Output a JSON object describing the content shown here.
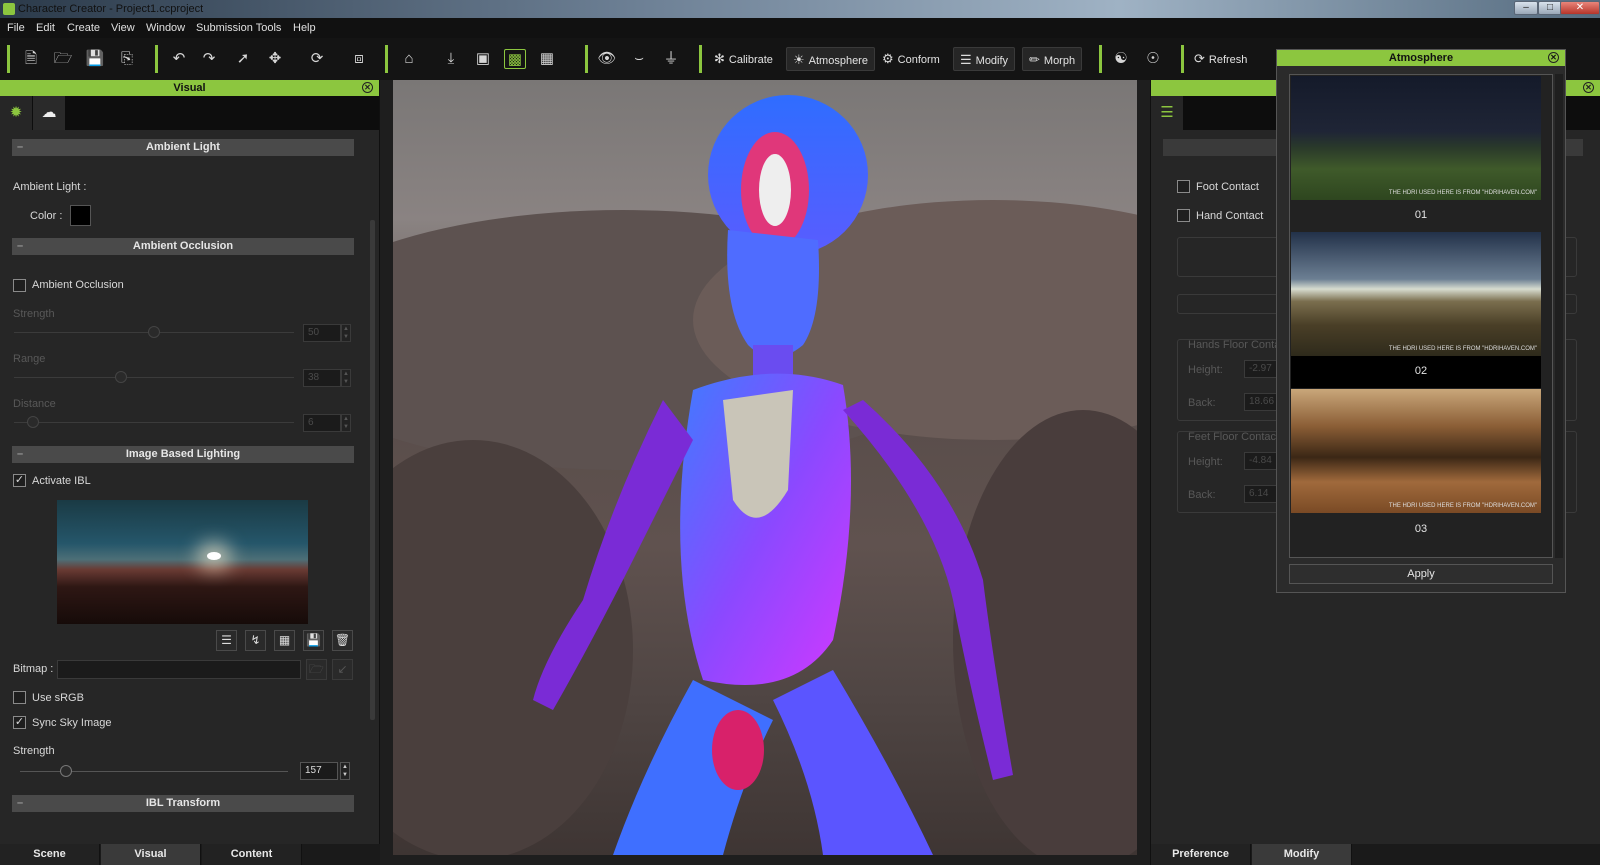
{
  "window": {
    "title": "Character Creator - Project1.ccproject"
  },
  "menu": [
    "File",
    "Edit",
    "Create",
    "View",
    "Window",
    "Submission Tools",
    "Help"
  ],
  "toolbar": {
    "calibrate": "Calibrate",
    "atmosphere": "Atmosphere",
    "conform": "Conform",
    "modify": "Modify",
    "morph": "Morph",
    "refresh": "Refresh"
  },
  "left_panel": {
    "title": "Visual",
    "ambient_light": {
      "section": "Ambient Light",
      "label": "Ambient Light :",
      "color_label": "Color :",
      "color": "#000000"
    },
    "ambient_occlusion": {
      "section": "Ambient Occlusion",
      "checkbox": "Ambient Occlusion",
      "checked": false,
      "strength_label": "Strength",
      "strength_value": "50",
      "range_label": "Range",
      "range_value": "38",
      "distance_label": "Distance",
      "distance_value": "6"
    },
    "ibl": {
      "section": "Image Based Lighting",
      "activate": "Activate IBL",
      "activate_checked": true,
      "bitmap_label": "Bitmap :",
      "bitmap_value": "",
      "use_srgb": "Use sRGB",
      "use_srgb_checked": false,
      "sync_sky": "Sync Sky Image",
      "sync_sky_checked": true,
      "strength_label": "Strength",
      "strength_value": "157"
    },
    "ibl_transform": {
      "section": "IBL Transform"
    },
    "bottom_tabs": [
      "Scene",
      "Visual",
      "Content"
    ],
    "active_tab": "Visual"
  },
  "right_panel": {
    "foot_contact": "Foot Contact",
    "hand_contact": "Hand Contact",
    "hands_floor_contact": "Hands Floor Conta",
    "feet_floor_contact": "Feet Floor Contact",
    "height_label": "Height:",
    "back_label": "Back:",
    "hands_height": "-2.97",
    "hands_back": "18.66",
    "feet_height": "-4.84",
    "feet_back": "6.14",
    "bottom_tabs": [
      "Preference",
      "Modify"
    ],
    "active_tab": "Modify"
  },
  "atmosphere_popup": {
    "title": "Atmosphere",
    "items": [
      {
        "caption": "01",
        "watermark": "THE HDRI USED HERE IS FROM \"HDRIHAVEN.COM\""
      },
      {
        "caption": "02",
        "watermark": "THE HDRI USED HERE IS FROM \"HDRIHAVEN.COM\""
      },
      {
        "caption": "03",
        "watermark": "THE HDRI USED HERE IS FROM \"HDRIHAVEN.COM\""
      }
    ],
    "selected": "02",
    "apply": "Apply"
  },
  "colors": {
    "accent": "#8cc63f",
    "panel": "#262626",
    "toolbar": "#141414"
  }
}
